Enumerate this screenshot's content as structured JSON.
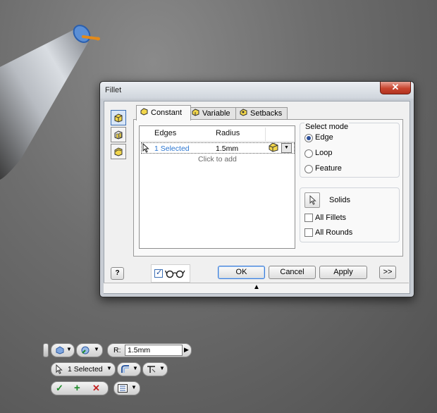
{
  "dialog": {
    "title": "Fillet",
    "close_glyph": "✕",
    "tabs": [
      {
        "label": "Constant",
        "icon": "fillet-constant-icon"
      },
      {
        "label": "Variable",
        "icon": "fillet-variable-icon"
      },
      {
        "label": "Setbacks",
        "icon": "fillet-setbacks-icon"
      }
    ],
    "mode_buttons": [
      "edge-fillet-icon",
      "face-fillet-icon",
      "full-round-fillet-icon"
    ],
    "table": {
      "columns": [
        "Edges",
        "Radius"
      ],
      "rows": [
        {
          "edges": "1 Selected",
          "radius": "1.5mm"
        }
      ],
      "add_hint": "Click to add"
    },
    "select_mode": {
      "label": "Select mode",
      "options": [
        "Edge",
        "Loop",
        "Feature"
      ],
      "selected": "Edge"
    },
    "solids_label": "Solids",
    "checkboxes": [
      {
        "label": "All Fillets",
        "checked": false
      },
      {
        "label": "All Rounds",
        "checked": false
      }
    ],
    "preview_checked": true,
    "buttons": {
      "ok": "OK",
      "cancel": "Cancel",
      "apply": "Apply",
      "more": ">>"
    },
    "help_glyph": "?",
    "grip_glyph": "▲"
  },
  "mini_toolbar": {
    "radius_label": "R:",
    "radius_value": "1.5mm",
    "edges_selected": "1 Selected",
    "apply_glyph": "✓",
    "apply_add_glyph": "+",
    "cancel_glyph": "✕"
  },
  "colors": {
    "accent_blue": "#2b76d1",
    "fillet_icon_yellow": "#f2d64b",
    "close_red": "#c8452f",
    "ok_green": "#1d8a2a",
    "cancel_red": "#c42020",
    "model_orange": "#e38a1a"
  }
}
